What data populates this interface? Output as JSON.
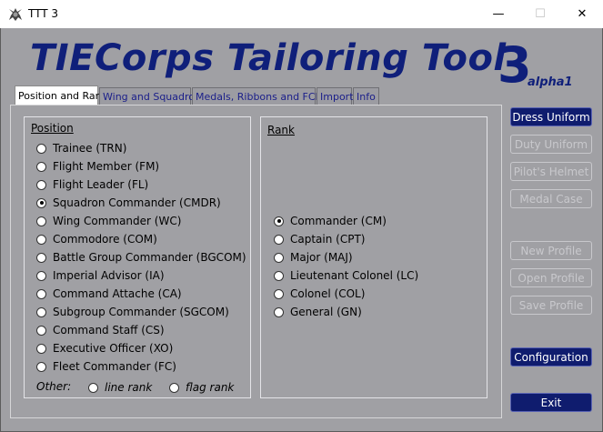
{
  "window": {
    "title": "TTT 3",
    "controls": {
      "minimize": "—",
      "maximize": "☐",
      "close": "✕"
    }
  },
  "logo": {
    "text": "TIECorps Tailoring Tool",
    "number": "3",
    "version": "alpha1"
  },
  "tabs": [
    {
      "label": "Position and Rank",
      "active": true
    },
    {
      "label": "Wing and Squadron",
      "active": false
    },
    {
      "label": "Medals, Ribbons and FCHG",
      "active": false
    },
    {
      "label": "Import",
      "active": false
    },
    {
      "label": "Info",
      "active": false
    }
  ],
  "position": {
    "title": "Position",
    "selected": "Squadron Commander (CMDR)",
    "options": [
      "Trainee (TRN)",
      "Flight Member (FM)",
      "Flight Leader (FL)",
      "Squadron Commander (CMDR)",
      "Wing Commander (WC)",
      "Commodore (COM)",
      "Battle Group Commander (BGCOM)",
      "Imperial Advisor (IA)",
      "Command Attache (CA)",
      "Subgroup Commander (SGCOM)",
      "Command Staff (CS)",
      "Executive Officer (XO)",
      "Fleet Commander (FC)"
    ],
    "other_label": "Other:",
    "other_options": [
      "line rank",
      "flag rank"
    ]
  },
  "rank": {
    "title": "Rank",
    "selected": "Commander (CM)",
    "options": [
      "Commander (CM)",
      "Captain (CPT)",
      "Major (MAJ)",
      "Lieutenant Colonel (LC)",
      "Colonel (COL)",
      "General (GN)"
    ]
  },
  "buttons": {
    "dress_uniform": "Dress Uniform",
    "duty_uniform": "Duty Uniform",
    "pilots_helmet": "Pilot's Helmet",
    "medal_case": "Medal Case",
    "new_profile": "New Profile",
    "open_profile": "Open Profile",
    "save_profile": "Save Profile",
    "configuration": "Configuration",
    "exit": "Exit"
  },
  "colors": {
    "brand_blue": "#0f1f7a",
    "background": "#a0a0a4",
    "button_primary": "#0f1c6e"
  }
}
